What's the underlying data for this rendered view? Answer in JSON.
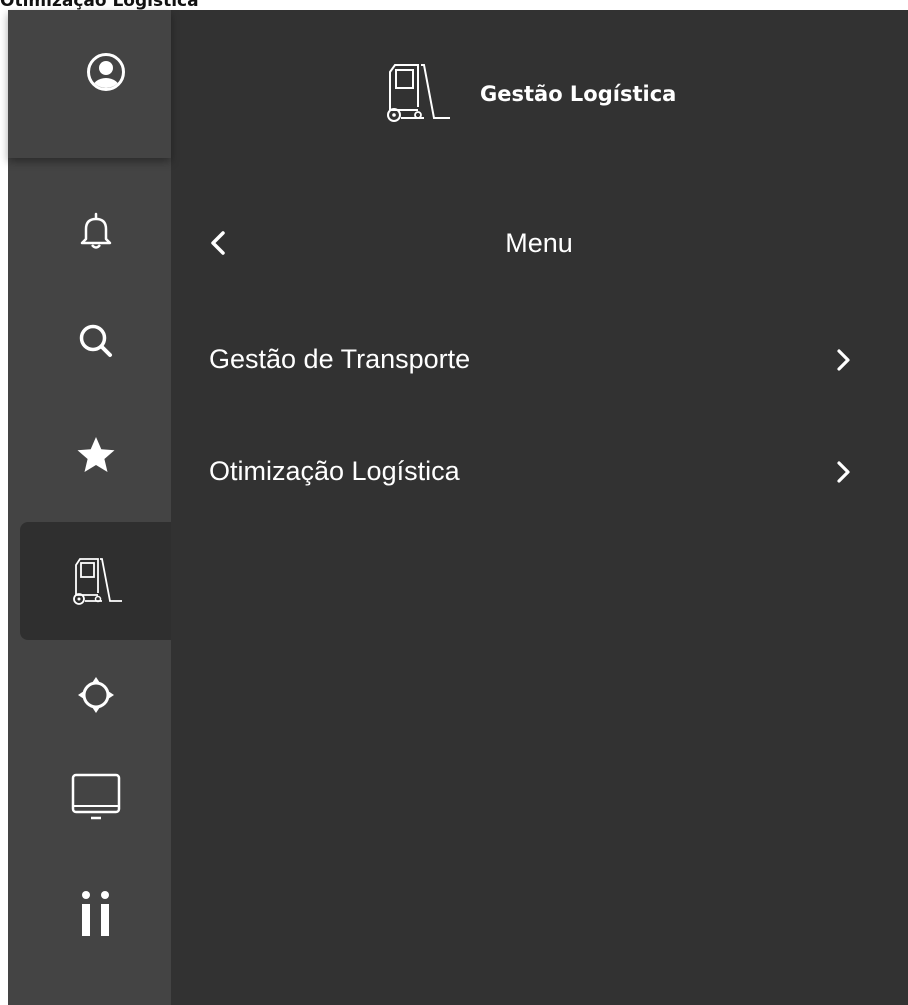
{
  "page": {
    "header_text": "Otimização Logística"
  },
  "brand": {
    "title": "Gestão Logística",
    "icon": "forklift-icon"
  },
  "rail": {
    "items": [
      {
        "icon": "user-avatar-icon",
        "active": false
      },
      {
        "icon": "bell-icon",
        "active": false
      },
      {
        "icon": "search-icon",
        "active": false
      },
      {
        "icon": "star-icon",
        "active": false
      },
      {
        "icon": "forklift-icon",
        "active": true
      },
      {
        "icon": "crosshair-icon",
        "active": false
      },
      {
        "icon": "monitor-icon",
        "active": false
      },
      {
        "icon": "info-icon",
        "active": false
      }
    ]
  },
  "menu": {
    "title": "Menu",
    "back_icon": "chevron-left-icon",
    "items": [
      {
        "label": "Gestão de Transporte",
        "icon": "chevron-right-icon"
      },
      {
        "label": "Otimização Logística",
        "icon": "chevron-right-icon"
      }
    ]
  },
  "colors": {
    "panel_bg": "#323232",
    "rail_bg": "#444444",
    "active_bg": "#2f2f2f",
    "text": "#ffffff"
  }
}
